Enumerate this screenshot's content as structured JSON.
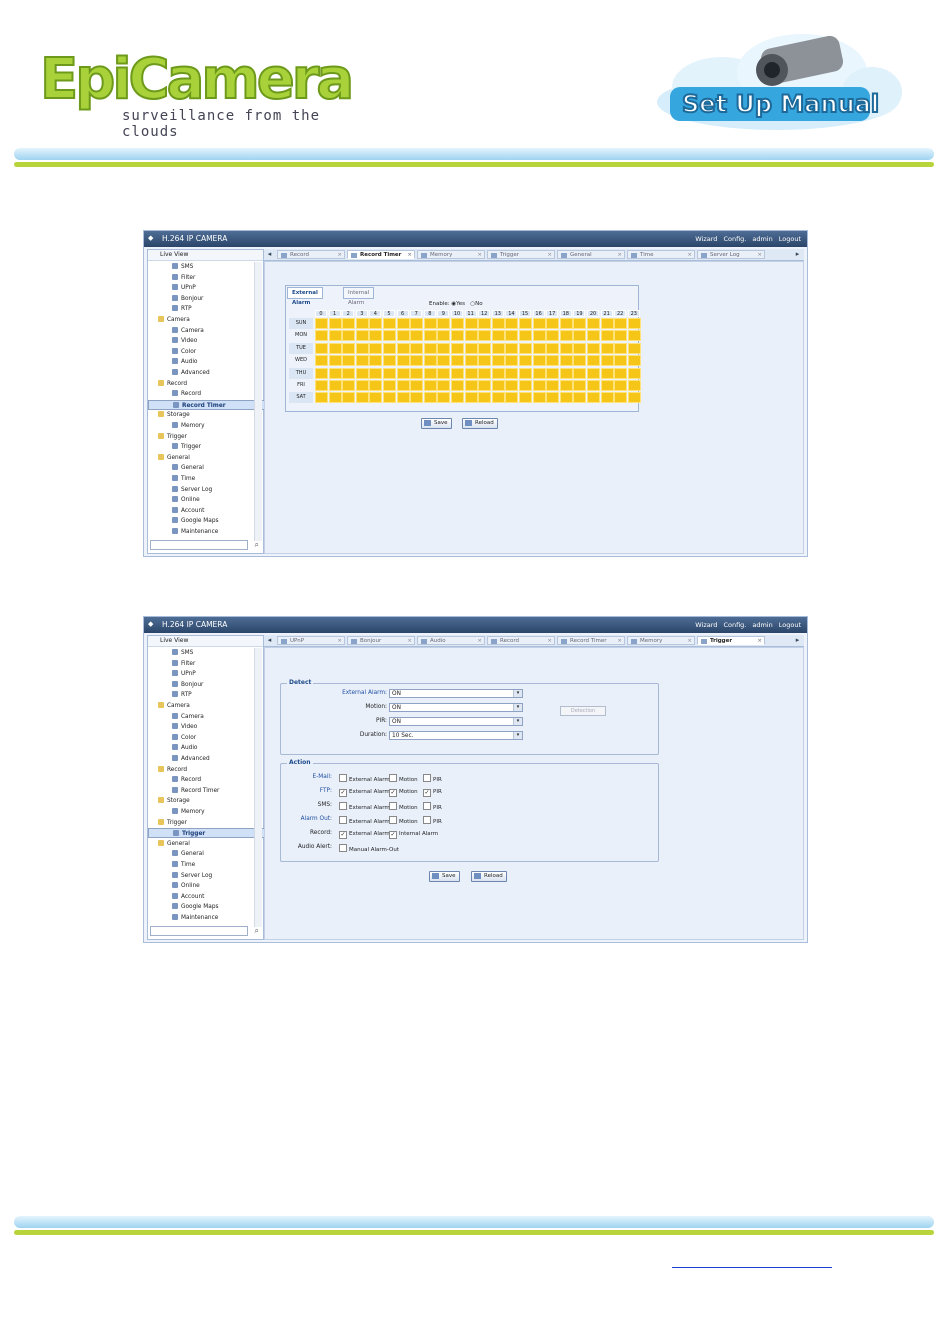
{
  "header": {
    "logo_text": "EpiCamera",
    "logo_tagline": "surveillance from the clouds",
    "badge_text": "Set Up Manual"
  },
  "colors": {
    "brand_green": "#a8d13a",
    "stripe_blue": "#9fd3f0",
    "tab_yellow": "#f5c518"
  },
  "app": {
    "title": "H.264 IP CAMERA",
    "top_links": [
      "Wizard",
      "Config.",
      "admin",
      "Logout"
    ],
    "live_view": "Live View"
  },
  "shot1": {
    "tree": [
      {
        "label": "SMS"
      },
      {
        "label": "Filter"
      },
      {
        "label": "UPnP"
      },
      {
        "label": "Bonjour"
      },
      {
        "label": "RTP"
      },
      {
        "label": "Camera",
        "folder": true
      },
      {
        "label": "Camera"
      },
      {
        "label": "Video"
      },
      {
        "label": "Color"
      },
      {
        "label": "Audio"
      },
      {
        "label": "Advanced"
      },
      {
        "label": "Record",
        "folder": true
      },
      {
        "label": "Record"
      },
      {
        "label": "Record Timer",
        "selected": true
      },
      {
        "label": "Storage",
        "folder": true
      },
      {
        "label": "Memory"
      },
      {
        "label": "Trigger",
        "folder": true
      },
      {
        "label": "Trigger"
      },
      {
        "label": "General",
        "folder": true
      },
      {
        "label": "General"
      },
      {
        "label": "Time"
      },
      {
        "label": "Server Log"
      },
      {
        "label": "Online"
      },
      {
        "label": "Account"
      },
      {
        "label": "Google Maps"
      },
      {
        "label": "Maintenance"
      }
    ],
    "tabs": [
      {
        "label": "Record"
      },
      {
        "label": "Record Timer",
        "active": true
      },
      {
        "label": "Memory"
      },
      {
        "label": "Trigger"
      },
      {
        "label": "General"
      },
      {
        "label": "Time"
      },
      {
        "label": "Server Log"
      }
    ],
    "subtabs": [
      "External Alarm",
      "Internal Alarm"
    ],
    "enable_label": "Enable:",
    "enable_yes": "Yes",
    "enable_no": "No",
    "hours": [
      "0",
      "1",
      "2",
      "3",
      "4",
      "5",
      "6",
      "7",
      "8",
      "9",
      "10",
      "11",
      "12",
      "13",
      "14",
      "15",
      "16",
      "17",
      "18",
      "19",
      "20",
      "21",
      "22",
      "23"
    ],
    "days": [
      "SUN",
      "MON",
      "TUE",
      "WED",
      "THU",
      "FRI",
      "SAT"
    ],
    "save_label": "Save",
    "reload_label": "Reload"
  },
  "shot2": {
    "tree": [
      {
        "label": "SMS"
      },
      {
        "label": "Filter"
      },
      {
        "label": "UPnP"
      },
      {
        "label": "Bonjour"
      },
      {
        "label": "RTP"
      },
      {
        "label": "Camera",
        "folder": true
      },
      {
        "label": "Camera"
      },
      {
        "label": "Video"
      },
      {
        "label": "Color"
      },
      {
        "label": "Audio"
      },
      {
        "label": "Advanced"
      },
      {
        "label": "Record",
        "folder": true
      },
      {
        "label": "Record"
      },
      {
        "label": "Record Timer"
      },
      {
        "label": "Storage",
        "folder": true
      },
      {
        "label": "Memory"
      },
      {
        "label": "Trigger",
        "folder": true
      },
      {
        "label": "Trigger",
        "selected": true
      },
      {
        "label": "General",
        "folder": true
      },
      {
        "label": "General"
      },
      {
        "label": "Time"
      },
      {
        "label": "Server Log"
      },
      {
        "label": "Online"
      },
      {
        "label": "Account"
      },
      {
        "label": "Google Maps"
      },
      {
        "label": "Maintenance"
      }
    ],
    "tabs": [
      {
        "label": "UPnP"
      },
      {
        "label": "Bonjour"
      },
      {
        "label": "Audio"
      },
      {
        "label": "Record"
      },
      {
        "label": "Record Timer"
      },
      {
        "label": "Memory"
      },
      {
        "label": "Trigger",
        "active": true
      }
    ],
    "detect_legend": "Detect",
    "detect_fields": [
      {
        "label": "External Alarm:",
        "value": "ON",
        "blue": true
      },
      {
        "label": "Motion:",
        "value": "ON"
      },
      {
        "label": "PIR:",
        "value": "ON"
      },
      {
        "label": "Duration:",
        "value": "10 Sec."
      }
    ],
    "detection_button": "Detection",
    "action_legend": "Action",
    "actions": [
      {
        "label": "E-Mail:",
        "blue": true,
        "options": [
          {
            "t": "External Alarm",
            "c": false
          },
          {
            "t": "Motion",
            "c": false
          },
          {
            "t": "PIR",
            "c": false
          }
        ]
      },
      {
        "label": "FTP:",
        "blue": true,
        "options": [
          {
            "t": "External Alarm",
            "c": true
          },
          {
            "t": "Motion",
            "c": true
          },
          {
            "t": "PIR",
            "c": true
          }
        ]
      },
      {
        "label": "SMS:",
        "options": [
          {
            "t": "External Alarm",
            "c": false
          },
          {
            "t": "Motion",
            "c": false
          },
          {
            "t": "PIR",
            "c": false
          }
        ]
      },
      {
        "label": "Alarm Out:",
        "blue": true,
        "options": [
          {
            "t": "External Alarm",
            "c": false
          },
          {
            "t": "Motion",
            "c": false
          },
          {
            "t": "PIR",
            "c": false
          }
        ]
      },
      {
        "label": "Record:",
        "options": [
          {
            "t": "External Alarm",
            "c": true
          },
          {
            "t": "Internal Alarm",
            "c": true
          }
        ]
      },
      {
        "label": "Audio Alert:",
        "options": [
          {
            "t": "Manual Alarm-Out",
            "c": false
          }
        ]
      }
    ],
    "save_label": "Save",
    "reload_label": "Reload"
  }
}
